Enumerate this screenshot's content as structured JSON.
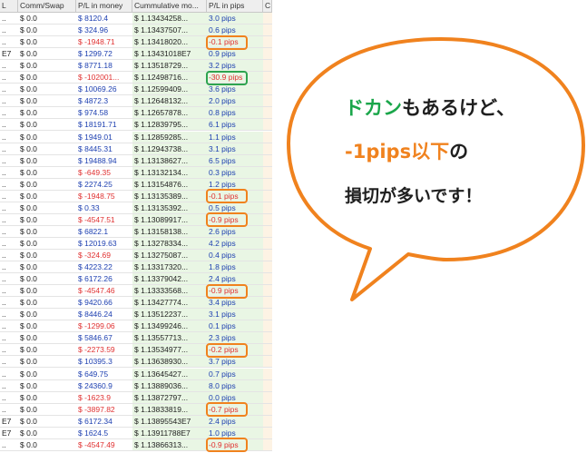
{
  "grid": {
    "headers": [
      "L",
      "Comm/Swap",
      "P/L in money",
      "Cummulative mo...",
      "P/L in pips",
      "C"
    ],
    "rows": [
      {
        "c0": "..",
        "comm": "$ 0.0",
        "pl": "$ 8120.4",
        "pl_neg": false,
        "cum": "$ 1.13434258...",
        "pips": "3.0 pips",
        "pips_neg": false
      },
      {
        "c0": "..",
        "comm": "$ 0.0",
        "pl": "$ 324.96",
        "pl_neg": false,
        "cum": "$ 1.13437507...",
        "pips": "0.6 pips",
        "pips_neg": false
      },
      {
        "c0": "..",
        "comm": "$ 0.0",
        "pl": "$ -1948.71",
        "pl_neg": true,
        "cum": "$ 1.13418020...",
        "pips": "-0.1 pips",
        "pips_neg": true
      },
      {
        "c0": "E7",
        "comm": "$ 0.0",
        "pl": "$ 1299.72",
        "pl_neg": false,
        "cum": "$ 1.13431018E7",
        "pips": "0.9 pips",
        "pips_neg": false
      },
      {
        "c0": "..",
        "comm": "$ 0.0",
        "pl": "$ 8771.18",
        "pl_neg": false,
        "cum": "$ 1.13518729...",
        "pips": "3.2 pips",
        "pips_neg": false
      },
      {
        "c0": "..",
        "comm": "$ 0.0",
        "pl": "$ -102001...",
        "pl_neg": true,
        "cum": "$ 1.12498716...",
        "pips": "-30.9 pips",
        "pips_neg": true
      },
      {
        "c0": "..",
        "comm": "$ 0.0",
        "pl": "$ 10069.26",
        "pl_neg": false,
        "cum": "$ 1.12599409...",
        "pips": "3.6 pips",
        "pips_neg": false
      },
      {
        "c0": "..",
        "comm": "$ 0.0",
        "pl": "$ 4872.3",
        "pl_neg": false,
        "cum": "$ 1.12648132...",
        "pips": "2.0 pips",
        "pips_neg": false
      },
      {
        "c0": "..",
        "comm": "$ 0.0",
        "pl": "$ 974.58",
        "pl_neg": false,
        "cum": "$ 1.12657878...",
        "pips": "0.8 pips",
        "pips_neg": false
      },
      {
        "c0": "..",
        "comm": "$ 0.0",
        "pl": "$ 18191.71",
        "pl_neg": false,
        "cum": "$ 1.12839795...",
        "pips": "6.1 pips",
        "pips_neg": false
      },
      {
        "c0": "..",
        "comm": "$ 0.0",
        "pl": "$ 1949.01",
        "pl_neg": false,
        "cum": "$ 1.12859285...",
        "pips": "1.1 pips",
        "pips_neg": false
      },
      {
        "c0": "..",
        "comm": "$ 0.0",
        "pl": "$ 8445.31",
        "pl_neg": false,
        "cum": "$ 1.12943738...",
        "pips": "3.1 pips",
        "pips_neg": false
      },
      {
        "c0": "..",
        "comm": "$ 0.0",
        "pl": "$ 19488.94",
        "pl_neg": false,
        "cum": "$ 1.13138627...",
        "pips": "6.5 pips",
        "pips_neg": false
      },
      {
        "c0": "..",
        "comm": "$ 0.0",
        "pl": "$ -649.35",
        "pl_neg": true,
        "cum": "$ 1.13132134...",
        "pips": "0.3 pips",
        "pips_neg": false
      },
      {
        "c0": "..",
        "comm": "$ 0.0",
        "pl": "$ 2274.25",
        "pl_neg": false,
        "cum": "$ 1.13154876...",
        "pips": "1.2 pips",
        "pips_neg": false
      },
      {
        "c0": "..",
        "comm": "$ 0.0",
        "pl": "$ -1948.75",
        "pl_neg": true,
        "cum": "$ 1.13135389...",
        "pips": "-0.1 pips",
        "pips_neg": true
      },
      {
        "c0": "..",
        "comm": "$ 0.0",
        "pl": "$ 0.33",
        "pl_neg": false,
        "cum": "$ 1.13135392...",
        "pips": "0.5 pips",
        "pips_neg": false
      },
      {
        "c0": "..",
        "comm": "$ 0.0",
        "pl": "$ -4547.51",
        "pl_neg": true,
        "cum": "$ 1.13089917...",
        "pips": "-0.9 pips",
        "pips_neg": true
      },
      {
        "c0": "..",
        "comm": "$ 0.0",
        "pl": "$ 6822.1",
        "pl_neg": false,
        "cum": "$ 1.13158138...",
        "pips": "2.6 pips",
        "pips_neg": false
      },
      {
        "c0": "..",
        "comm": "$ 0.0",
        "pl": "$ 12019.63",
        "pl_neg": false,
        "cum": "$ 1.13278334...",
        "pips": "4.2 pips",
        "pips_neg": false
      },
      {
        "c0": "..",
        "comm": "$ 0.0",
        "pl": "$ -324.69",
        "pl_neg": true,
        "cum": "$ 1.13275087...",
        "pips": "0.4 pips",
        "pips_neg": false
      },
      {
        "c0": "..",
        "comm": "$ 0.0",
        "pl": "$ 4223.22",
        "pl_neg": false,
        "cum": "$ 1.13317320...",
        "pips": "1.8 pips",
        "pips_neg": false
      },
      {
        "c0": "..",
        "comm": "$ 0.0",
        "pl": "$ 6172.26",
        "pl_neg": false,
        "cum": "$ 1.13379042...",
        "pips": "2.4 pips",
        "pips_neg": false
      },
      {
        "c0": "..",
        "comm": "$ 0.0",
        "pl": "$ -4547.46",
        "pl_neg": true,
        "cum": "$ 1.13333568...",
        "pips": "-0.9 pips",
        "pips_neg": true
      },
      {
        "c0": "..",
        "comm": "$ 0.0",
        "pl": "$ 9420.66",
        "pl_neg": false,
        "cum": "$ 1.13427774...",
        "pips": "3.4 pips",
        "pips_neg": false
      },
      {
        "c0": "..",
        "comm": "$ 0.0",
        "pl": "$ 8446.24",
        "pl_neg": false,
        "cum": "$ 1.13512237...",
        "pips": "3.1 pips",
        "pips_neg": false
      },
      {
        "c0": "..",
        "comm": "$ 0.0",
        "pl": "$ -1299.06",
        "pl_neg": true,
        "cum": "$ 1.13499246...",
        "pips": "0.1 pips",
        "pips_neg": false
      },
      {
        "c0": "..",
        "comm": "$ 0.0",
        "pl": "$ 5846.67",
        "pl_neg": false,
        "cum": "$ 1.13557713...",
        "pips": "2.3 pips",
        "pips_neg": false
      },
      {
        "c0": "..",
        "comm": "$ 0.0",
        "pl": "$ -2273.59",
        "pl_neg": true,
        "cum": "$ 1.13534977...",
        "pips": "-0.2 pips",
        "pips_neg": true
      },
      {
        "c0": "..",
        "comm": "$ 0.0",
        "pl": "$ 10395.3",
        "pl_neg": false,
        "cum": "$ 1.13638930...",
        "pips": "3.7 pips",
        "pips_neg": false
      },
      {
        "c0": "..",
        "comm": "$ 0.0",
        "pl": "$ 649.75",
        "pl_neg": false,
        "cum": "$ 1.13645427...",
        "pips": "0.7 pips",
        "pips_neg": false
      },
      {
        "c0": "..",
        "comm": "$ 0.0",
        "pl": "$ 24360.9",
        "pl_neg": false,
        "cum": "$ 1.13889036...",
        "pips": "8.0 pips",
        "pips_neg": false
      },
      {
        "c0": "..",
        "comm": "$ 0.0",
        "pl": "$ -1623.9",
        "pl_neg": true,
        "cum": "$ 1.13872797...",
        "pips": "0.0 pips",
        "pips_neg": false
      },
      {
        "c0": "..",
        "comm": "$ 0.0",
        "pl": "$ -3897.82",
        "pl_neg": true,
        "cum": "$ 1.13833819...",
        "pips": "-0.7 pips",
        "pips_neg": true
      },
      {
        "c0": "E7",
        "comm": "$ 0.0",
        "pl": "$ 6172.34",
        "pl_neg": false,
        "cum": "$ 1.13895543E7",
        "pips": "2.4 pips",
        "pips_neg": false
      },
      {
        "c0": "E7",
        "comm": "$ 0.0",
        "pl": "$ 1624.5",
        "pl_neg": false,
        "cum": "$ 1.13911788E7",
        "pips": "1.0 pips",
        "pips_neg": false
      },
      {
        "c0": "..",
        "comm": "$ 0.0",
        "pl": "$ -4547.49",
        "pl_neg": true,
        "cum": "$ 1.13866313...",
        "pips": "-0.9 pips",
        "pips_neg": true
      }
    ],
    "highlight_orange_rows": [
      2,
      15,
      17,
      23,
      28,
      33,
      36
    ],
    "highlight_green_rows": [
      5
    ]
  },
  "bubble": {
    "line1_green": "ドカン",
    "line1_rest": "もあるけど、",
    "line2_orange": "-1pips以下",
    "line2_rest": "の",
    "line3": "損切が多いです！",
    "colors": {
      "border": "#f0821e",
      "fill": "#ffffff",
      "green": "#1aa64a",
      "orange": "#f0821e"
    }
  }
}
